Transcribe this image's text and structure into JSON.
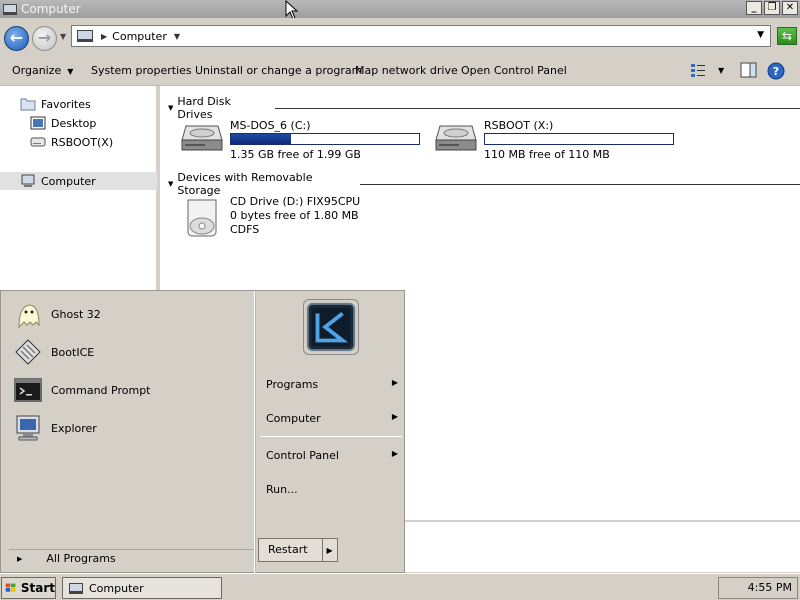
{
  "window": {
    "title": "Computer"
  },
  "address": {
    "location": "Computer"
  },
  "toolbar": {
    "organize": "Organize",
    "system_properties": "System properties",
    "uninstall": "Uninstall or change a program",
    "map_network": "Map network drive",
    "open_control_panel": "Open Control Panel"
  },
  "nav": {
    "favorites": "Favorites",
    "desktop": "Desktop",
    "rsboot": "RSBOOT(X)",
    "computer": "Computer"
  },
  "groups": {
    "hard_disk": "Hard Disk Drives",
    "removable": "Devices with Removable Storage"
  },
  "drives": [
    {
      "name": "MS-DOS_6 (C:)",
      "free": "1.35 GB free of 1.99 GB",
      "used_fraction": 0.32
    },
    {
      "name": "RSBOOT (X:)",
      "free": "110 MB free of 110 MB",
      "used_fraction": 0.0
    }
  ],
  "cd": {
    "name": "CD Drive (D:) FIX95CPU",
    "free": "0 bytes free of 1.80 MB",
    "fs": "CDFS"
  },
  "startmenu": {
    "programs_left": [
      "Ghost 32",
      "BootICE",
      "Command Prompt",
      "Explorer"
    ],
    "all_programs": "All Programs",
    "right": {
      "programs": "Programs",
      "computer": "Computer",
      "control_panel": "Control Panel",
      "run": "Run..."
    },
    "restart": "Restart"
  },
  "taskbar": {
    "start": "Start",
    "task": "Computer",
    "clock": "4:55 PM"
  },
  "colors": {
    "progress": "#1a4ba6",
    "background": "#d4d0c8"
  }
}
